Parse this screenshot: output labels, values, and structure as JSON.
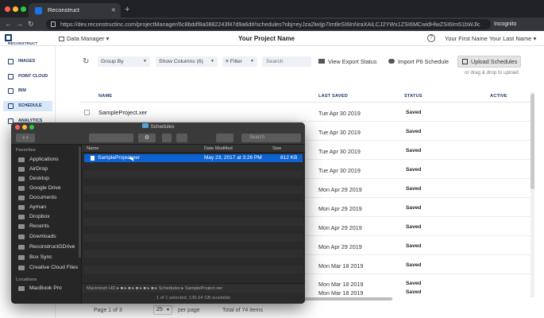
{
  "browser": {
    "tab_title": "Reconstruct",
    "url": "https://dev.reconstructinc.com/projectManager/6c8bddf8a0882243f47d9a6d#/schedules?obj=eyJza2lwIjp7ImtleSI6InNraXAiLCJ2YWx1ZSI6MCwidHlwZSI6Im51bWJlc",
    "incognito_label": "Incognito"
  },
  "header": {
    "logo_text": "RECONSTRUCT",
    "data_manager": "Data Manager",
    "project_name": "Your Project Name",
    "user_name": "Your First Name Your Last Name"
  },
  "sidebar": {
    "items": [
      {
        "label": "IMAGES",
        "icon": "images-icon"
      },
      {
        "label": "POINT CLOUD",
        "icon": "point-cloud-icon"
      },
      {
        "label": "BIM",
        "icon": "bim-icon"
      },
      {
        "label": "SCHEDULE",
        "icon": "schedule-icon"
      },
      {
        "label": "ANALYTICS",
        "icon": "analytics-icon"
      }
    ]
  },
  "toolbar": {
    "group_by": "Group By",
    "show_columns": "Show Columns (6)",
    "filter": "Filter",
    "search_placeholder": "Search",
    "view_export": "View Export Status",
    "import_p6": "Import P6 Schedule",
    "upload": "Upload Schedules",
    "drop_hint": "or drag & drop to upload"
  },
  "table": {
    "columns": {
      "name": "NAME",
      "last_saved": "LAST SAVED",
      "status": "STATUS",
      "active": "ACTIVE"
    },
    "rows": [
      {
        "name": "SampleProject.xer",
        "date": "Tue Apr 30 2019",
        "status": "Saved"
      },
      {
        "name": "",
        "date": "Tue Apr 30 2019",
        "status": "Saved"
      },
      {
        "name": "",
        "date": "Tue Apr 30 2019",
        "status": "Saved"
      },
      {
        "name": "",
        "date": "Tue Apr 30 2019",
        "status": "Saved"
      },
      {
        "name": "",
        "date": "Mon Apr 29 2019",
        "status": "Saved"
      },
      {
        "name": "",
        "date": "Mon Apr 29 2019",
        "status": "Saved"
      },
      {
        "name": "",
        "date": "Mon Apr 29 2019",
        "status": "Saved"
      },
      {
        "name": "",
        "date": "Mon Apr 29 2019",
        "status": "Saved"
      },
      {
        "name": "",
        "date": "Mon Mar 18 2019",
        "status": "Saved"
      },
      {
        "name": "",
        "date": "Mon Mar 18 2019",
        "status": "Saved"
      },
      {
        "name": "",
        "date": "Mon Mar 18 2019",
        "status": "Saved"
      }
    ]
  },
  "footer": {
    "page_of": "Page 1 of 3",
    "per_page_value": "25",
    "per_page_label": "per page",
    "total": "Total of 74 items"
  },
  "finder": {
    "title": "Schedules",
    "search_placeholder": "Search",
    "favorites_label": "Favorites",
    "favorites": [
      "Applications",
      "AirDrop",
      "Desktop",
      "Google Drive",
      "Documents",
      "Ayman",
      "Dropbox",
      "Recents",
      "Downloads",
      "ReconstructGDrive",
      "Box Sync",
      "Creative Cloud Files"
    ],
    "locations_label": "Locations",
    "locations": [
      "MacBook Pro"
    ],
    "columns": {
      "name": "Name",
      "modified": "Date Modified",
      "size": "Size"
    },
    "file": {
      "name": "SampleProject.xer",
      "modified": "May 23, 2017 at 3:26 PM",
      "size": "812 KB"
    },
    "path": "Macintosh HD ▸ ■ ▸ ■ ▸ ■ ▸ ■ ▸ ■ ▸ Schedules ▸ SampleProject.xer",
    "status": "1 of 1 selected, 135.64 GB available"
  },
  "colors": {
    "brand": "#1b3a6b",
    "selection": "#0d62d2",
    "active_nav": "#d8e8f8"
  }
}
